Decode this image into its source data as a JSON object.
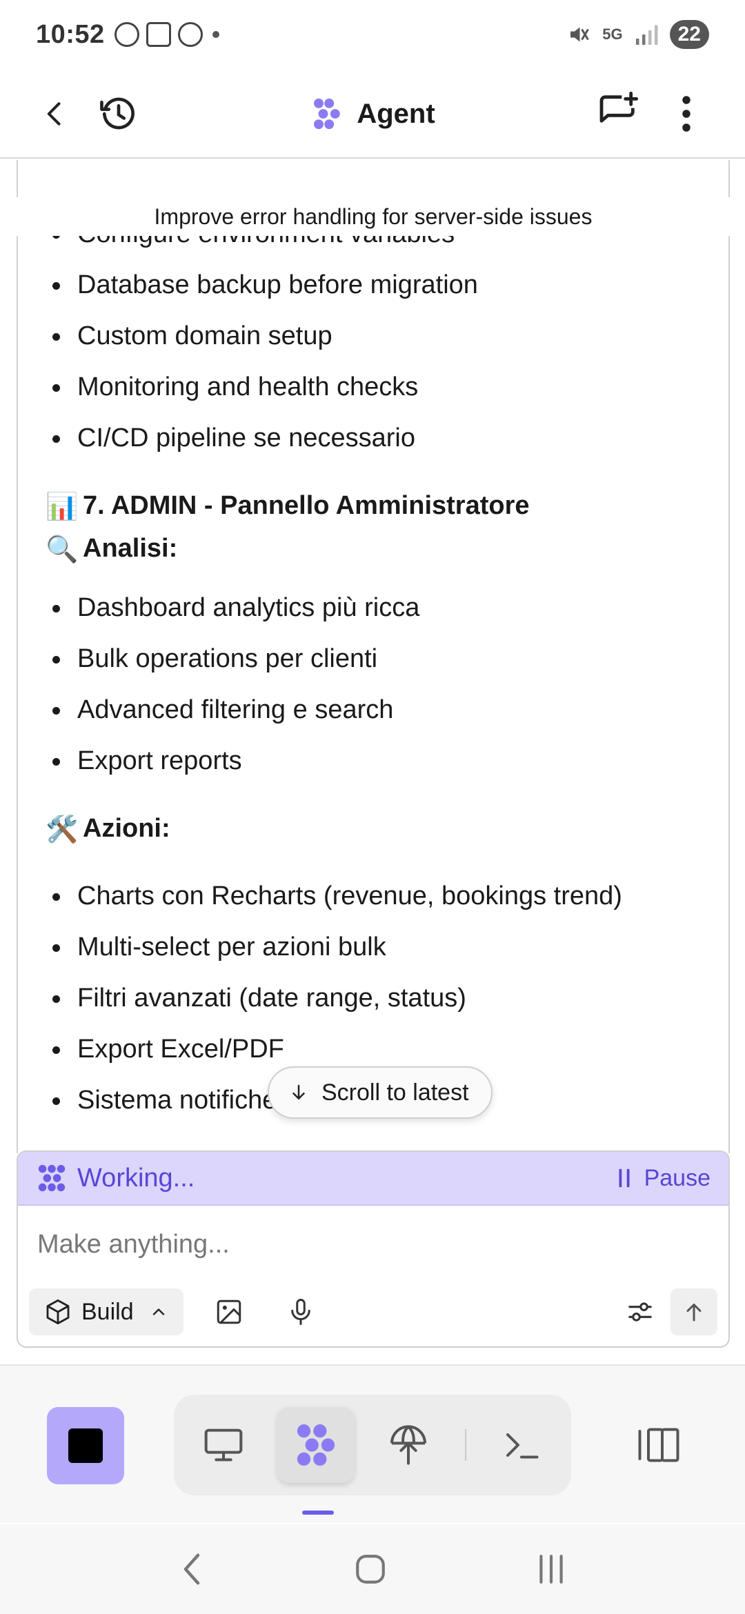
{
  "status_bar": {
    "time": "10:52",
    "network": "5G",
    "battery": "22"
  },
  "header": {
    "title": "Agent"
  },
  "conversation": {
    "task_title": "Improve error handling for server-side issues",
    "deploy_items": [
      "Configure environment variables",
      "Database backup before migration",
      "Custom domain setup",
      "Monitoring and health checks",
      "CI/CD pipeline se necessario"
    ],
    "admin_section": {
      "heading_emoji": "📊",
      "heading": "7. ADMIN - Pannello Amministratore",
      "analysis_emoji": "🔍",
      "analysis_heading": "Analisi:",
      "analysis_items": [
        "Dashboard analytics più ricca",
        "Bulk operations per clienti",
        "Advanced filtering e search",
        "Export reports"
      ],
      "actions_emoji": "🛠️",
      "actions_heading": "Azioni:",
      "actions_items": [
        "Charts con Recharts (revenue, bookings trend)",
        "Multi-select per azioni bulk",
        "Filtri avanzati (date range, status)",
        "Export Excel/PDF",
        "Sistema notifiche admin più ricco"
      ]
    },
    "scroll_to_latest": "Scroll to latest"
  },
  "composer": {
    "working": "Working...",
    "pause": "Pause",
    "placeholder": "Make anything...",
    "mode": "Build"
  },
  "colors": {
    "accent": "#6d5ce8",
    "working_bg": "#dcd6fd",
    "stop_bg": "#b4a8fb"
  }
}
